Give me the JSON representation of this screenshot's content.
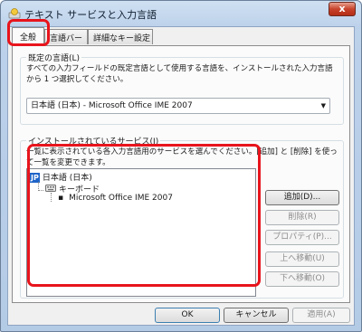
{
  "window": {
    "title": "テキスト サービスと入力言語",
    "close_label": "x"
  },
  "tabs": [
    {
      "label": "全般",
      "active": true
    },
    {
      "label": "言語バー",
      "active": false
    },
    {
      "label": "詳細なキー設定",
      "active": false
    }
  ],
  "default_language": {
    "group_title": "既定の言語(L)",
    "description": "すべての入力フィールドの既定言語として使用する言語を、インストールされた入力言語から 1 つ選択してください。",
    "selected": "日本語 (日本) - Microsoft Office IME 2007"
  },
  "installed_services": {
    "group_title": "インストールされているサービス(I)",
    "description": "一覧に表示されている各入力言語用のサービスを選んでください。[追加] と [削除] を使って一覧を変更できます。",
    "tree": {
      "language_code": "JP",
      "language": "日本語 (日本)",
      "category": "キーボード",
      "service": "Microsoft Office IME 2007"
    },
    "buttons": {
      "add": "追加(D)...",
      "remove": "削除(R)",
      "properties": "プロパティ(P)...",
      "move_up": "上へ移動(U)",
      "move_down": "下へ移動(O)"
    }
  },
  "footer": {
    "ok": "OK",
    "cancel": "キャンセル",
    "apply": "適用(A)"
  },
  "colors": {
    "highlight": "#e8141c",
    "language_badge": "#1e64c8"
  }
}
